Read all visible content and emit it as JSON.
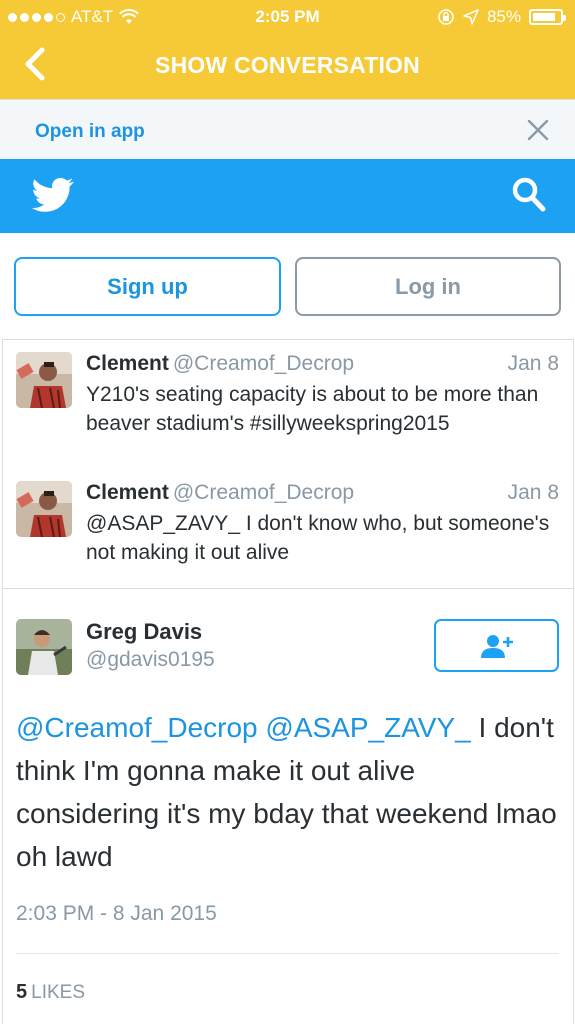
{
  "status_bar": {
    "carrier": "AT&T",
    "time": "2:05 PM",
    "battery": "85%"
  },
  "nav": {
    "title": "SHOW CONVERSATION"
  },
  "open_in_app": {
    "label": "Open in app"
  },
  "auth": {
    "signup_label": "Sign up",
    "login_label": "Log in"
  },
  "conversation": [
    {
      "name": "Clement",
      "handle": "@Creamof_Decrop",
      "date": "Jan 8",
      "text": "Y210's seating capacity is about to be more than beaver stadium's #sillyweekspring2015"
    },
    {
      "name": "Clement",
      "handle": "@Creamof_Decrop",
      "date": "Jan 8",
      "text": "@ASAP_ZAVY_ I don't know who, but someone's not making it out alive"
    }
  ],
  "main_tweet": {
    "name": "Greg Davis",
    "handle": "@gdavis0195",
    "mention_1": "@Creamof_Decrop",
    "mention_2": "@ASAP_ZAVY_",
    "text": " I don't think I'm gonna make it out alive considering it's my bday that weekend lmao oh lawd",
    "timestamp": "2:03 PM - 8 Jan 2015",
    "likes_count": "5",
    "likes_label": "LIKES"
  },
  "colors": {
    "nav_yellow": "#f6c936",
    "twitter_blue": "#1da1f2",
    "link_blue": "#1b95e0",
    "muted_gray": "#8899a6"
  }
}
